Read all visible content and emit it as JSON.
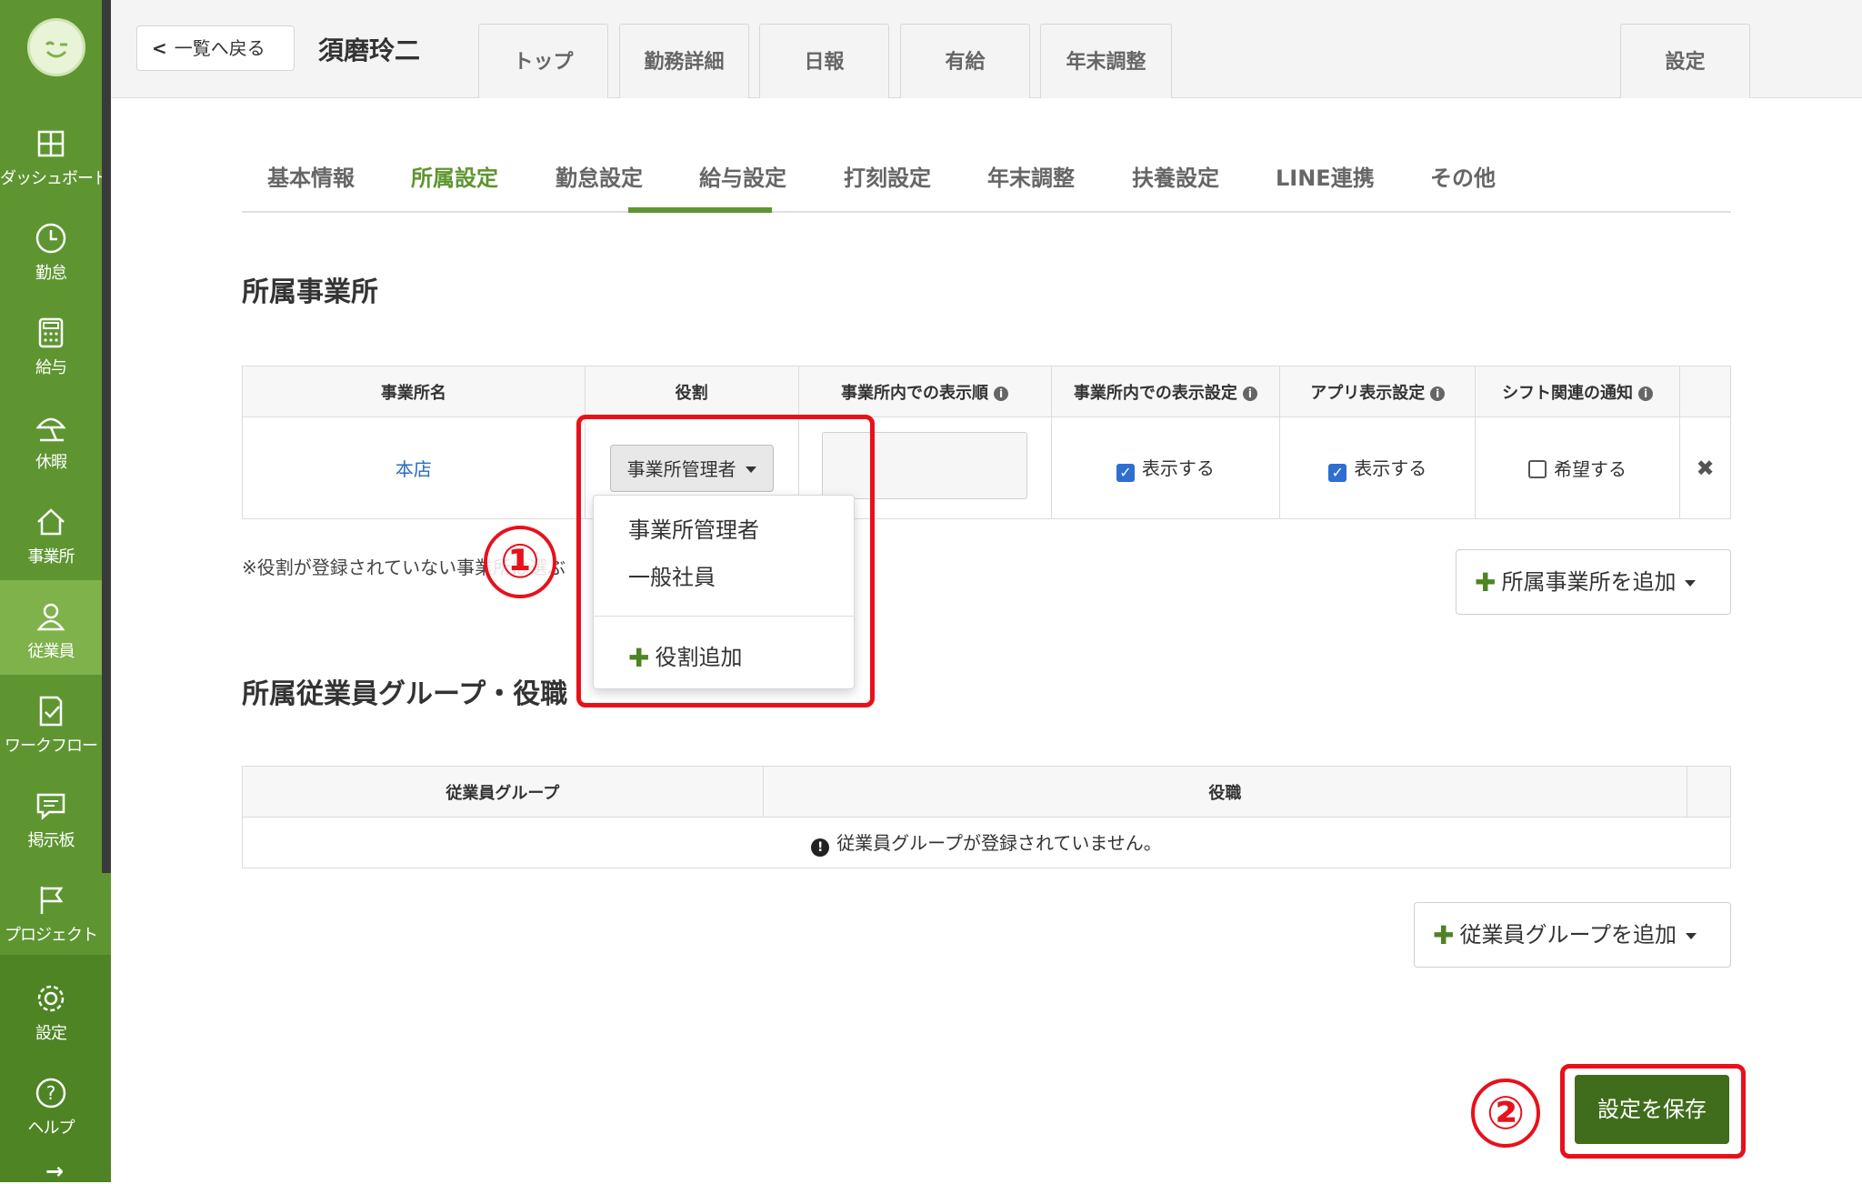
{
  "sidebar": {
    "items": [
      {
        "label": "ダッシュボード",
        "icon": "dashboard-icon"
      },
      {
        "label": "勤怠",
        "icon": "clock-icon"
      },
      {
        "label": "給与",
        "icon": "calculator-icon"
      },
      {
        "label": "休暇",
        "icon": "beach-umbrella-icon"
      },
      {
        "label": "事業所",
        "icon": "home-icon"
      },
      {
        "label": "従業員",
        "icon": "user-icon"
      },
      {
        "label": "ワークフロー",
        "icon": "document-check-icon"
      },
      {
        "label": "掲示板",
        "icon": "chat-icon"
      },
      {
        "label": "プロジェクト",
        "icon": "flag-icon"
      },
      {
        "label": "設定",
        "icon": "gear-icon"
      },
      {
        "label": "ヘルプ",
        "icon": "help-icon"
      }
    ]
  },
  "header": {
    "back_label": "一覧へ戻る",
    "employee_name": "須磨玲二",
    "tabs": [
      "トップ",
      "勤務詳細",
      "日報",
      "有給",
      "年末調整"
    ],
    "settings_tab": "設定"
  },
  "subtabs": [
    "基本情報",
    "所属設定",
    "勤怠設定",
    "給与設定",
    "打刻設定",
    "年末調整",
    "扶養設定",
    "LINE連携",
    "その他"
  ],
  "office_section": {
    "title": "所属事業所",
    "columns": [
      "事業所名",
      "役割",
      "事業所内での表示順",
      "事業所内での表示設定",
      "アプリ表示設定",
      "シフト関連の通知"
    ],
    "row": {
      "office_name": "本店",
      "role": "事業所管理者",
      "order_value": "",
      "display_in_office": "表示する",
      "app_display": "表示する",
      "shift_notify": "希望する",
      "display_in_office_checked": true,
      "app_display_checked": true,
      "shift_notify_checked": false
    },
    "note": "※役割が登録されていない事業所は選ぶ",
    "add_button": "所属事業所を追加"
  },
  "role_dropdown": {
    "options": [
      "事業所管理者",
      "一般社員"
    ],
    "add_role": "役割追加"
  },
  "group_section": {
    "title": "所属従業員グループ・役職",
    "columns": [
      "従業員グループ",
      "役職"
    ],
    "empty_message": "従業員グループが登録されていません。",
    "add_button": "従業員グループを追加"
  },
  "save_button": "設定を保存",
  "annotations": {
    "marker1": "①",
    "marker2": "②"
  },
  "colors": {
    "brand": "#5e9531",
    "save": "#3f6d1b",
    "annotation": "#e8111b",
    "link": "#2a6eb8"
  }
}
